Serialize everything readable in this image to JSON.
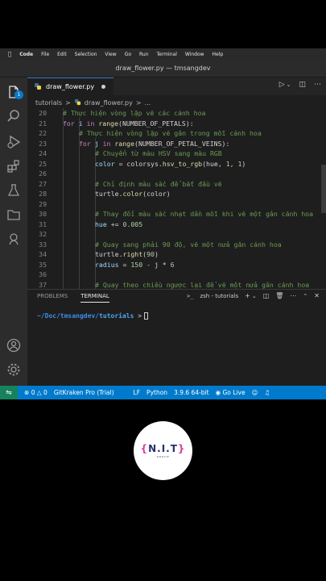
{
  "menubar": {
    "items": [
      "Code",
      "File",
      "Edit",
      "Selection",
      "View",
      "Go",
      "Run",
      "Terminal",
      "Window",
      "Help"
    ]
  },
  "window": {
    "title": "draw_flower.py — tmsangdev"
  },
  "activity": {
    "badge": "1",
    "icons": [
      "files-icon",
      "search-icon",
      "run-debug-icon",
      "extensions-icon",
      "testing-icon",
      "folder-icon",
      "gitkraken-icon",
      "account-icon",
      "settings-gear-icon"
    ]
  },
  "tab": {
    "label": "draw_flower.py"
  },
  "breadcrumb": {
    "folder": "tutorials",
    "sep": ">",
    "file": "draw_flower.py",
    "symbol": "..."
  },
  "code": [
    {
      "n": "20",
      "indent": 1,
      "parts": [
        [
          "cm",
          "# Thực hiện vòng lặp vẽ các cánh hoa"
        ]
      ]
    },
    {
      "n": "21",
      "indent": 1,
      "parts": [
        [
          "kw",
          "for "
        ],
        [
          "vr",
          "i "
        ],
        [
          "kw",
          "in "
        ],
        [
          "fn",
          "range"
        ],
        [
          "tx",
          "(NUMBER_OF_PETALS):"
        ]
      ]
    },
    {
      "n": "22",
      "indent": 2,
      "parts": [
        [
          "cm",
          "# Thực hiện vòng lặp vẽ gân trong mỗi cánh hoa"
        ]
      ]
    },
    {
      "n": "23",
      "indent": 2,
      "parts": [
        [
          "kw",
          "for "
        ],
        [
          "vr",
          "j "
        ],
        [
          "kw",
          "in "
        ],
        [
          "fn",
          "range"
        ],
        [
          "tx",
          "(NUMBER_OF_PETAL_VEINS):"
        ]
      ]
    },
    {
      "n": "24",
      "indent": 3,
      "parts": [
        [
          "cm",
          "# Chuyển từ màu HSV sang màu RGB"
        ]
      ]
    },
    {
      "n": "25",
      "indent": 3,
      "parts": [
        [
          "vr",
          "color "
        ],
        [
          "tx",
          "= colorsys."
        ],
        [
          "fn",
          "hsv_to_rgb"
        ],
        [
          "tx",
          "(hue, "
        ],
        [
          "nm",
          "1"
        ],
        [
          "tx",
          ", "
        ],
        [
          "nm",
          "1"
        ],
        [
          "tx",
          ")"
        ]
      ]
    },
    {
      "n": "26",
      "indent": 3,
      "parts": []
    },
    {
      "n": "27",
      "indent": 3,
      "parts": [
        [
          "cm",
          "# Chỉ định màu sắc để bắt đầu vẽ"
        ]
      ]
    },
    {
      "n": "28",
      "indent": 3,
      "parts": [
        [
          "tx",
          "turtle."
        ],
        [
          "fn",
          "color"
        ],
        [
          "tx",
          "(color)"
        ]
      ]
    },
    {
      "n": "29",
      "indent": 3,
      "parts": []
    },
    {
      "n": "30",
      "indent": 3,
      "parts": [
        [
          "cm",
          "# Thay đổi màu sắc nhạt dần mỗi khi vẽ một gân cánh hoa"
        ]
      ]
    },
    {
      "n": "31",
      "indent": 3,
      "parts": [
        [
          "vr",
          "hue "
        ],
        [
          "tx",
          "+= "
        ],
        [
          "nm",
          "0.005"
        ]
      ]
    },
    {
      "n": "32",
      "indent": 3,
      "parts": []
    },
    {
      "n": "33",
      "indent": 3,
      "parts": [
        [
          "cm",
          "# Quay sang phải 90 độ, vẽ một nửa gân cánh hoa"
        ]
      ]
    },
    {
      "n": "34",
      "indent": 3,
      "parts": [
        [
          "tx",
          "turtle."
        ],
        [
          "fn",
          "right"
        ],
        [
          "tx",
          "("
        ],
        [
          "nm",
          "90"
        ],
        [
          "tx",
          ")"
        ]
      ]
    },
    {
      "n": "35",
      "indent": 3,
      "parts": [
        [
          "vr",
          "radius "
        ],
        [
          "tx",
          "= "
        ],
        [
          "nm",
          "150 "
        ],
        [
          "tx",
          "- j * "
        ],
        [
          "nm",
          "6"
        ]
      ]
    },
    {
      "n": "36",
      "indent": 3,
      "parts": []
    },
    {
      "n": "37",
      "indent": 3,
      "parts": [
        [
          "cm",
          "# Quay theo chiều ngược lại để vẽ một nửa gân cánh hoa"
        ]
      ]
    }
  ],
  "panel": {
    "tabs": [
      "PROBLEMS",
      "TERMINAL"
    ],
    "terminal_name": "zsh - tutorials",
    "prompt_path": "~/Doc/tmsangdev/",
    "prompt_dir": "tutorials",
    "prompt_symbol": ">"
  },
  "status": {
    "errors": "0",
    "warnings": "0",
    "gitkraken": "GitKraken Pro (Trial)",
    "eol": "LF",
    "language": "Python",
    "interpreter": "3.9.6 64-bit",
    "golive": "Go Live"
  },
  "logo": {
    "text": "N.I.T",
    "sub": "GROUP"
  },
  "colors": {
    "statusbar": "#007acc",
    "remote": "#16825d",
    "badge": "#0a7aca",
    "logo_brace": "#d63fa0",
    "logo_text": "#2b2f6b"
  }
}
